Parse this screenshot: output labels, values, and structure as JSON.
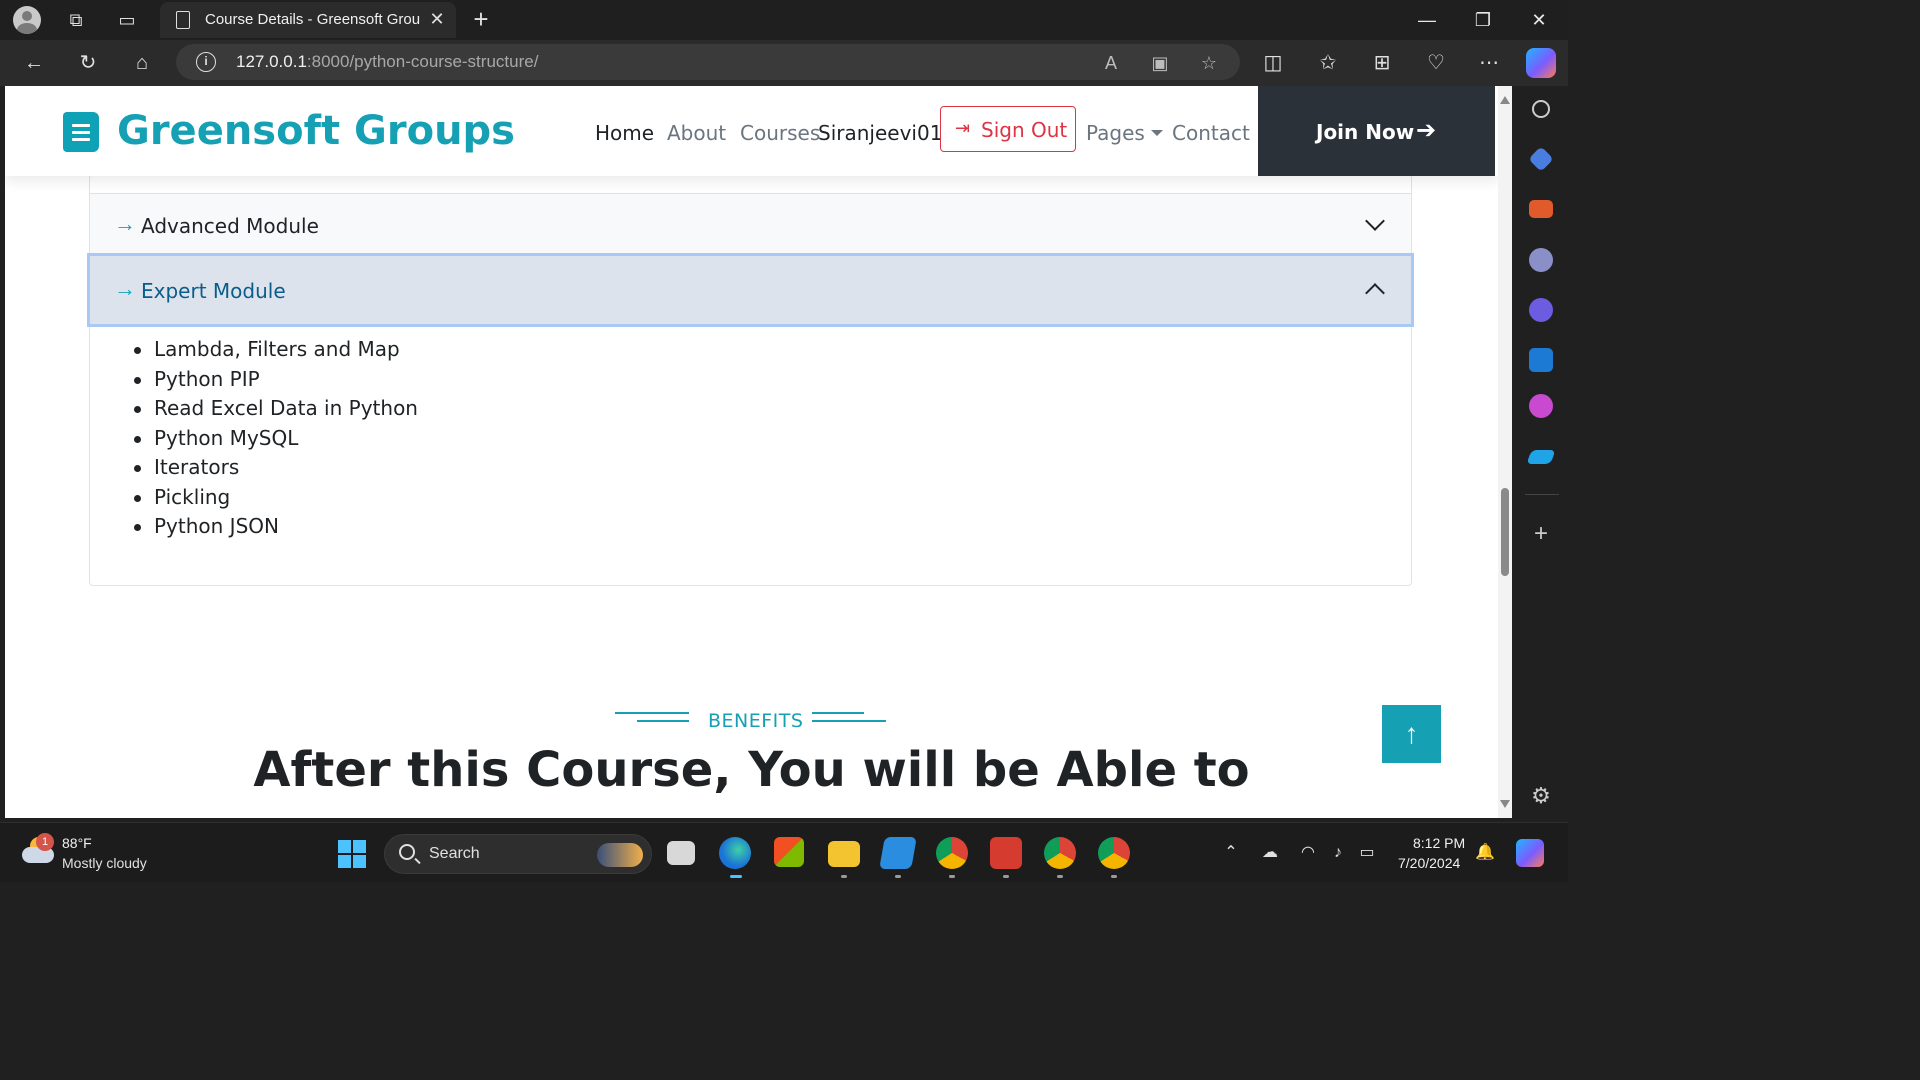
{
  "browser": {
    "tab_title": "Course Details - Greensoft Group",
    "url_host": "127.0.0.1",
    "url_rest": ":8000/python-course-structure/"
  },
  "site": {
    "brand": "Greensoft Groups",
    "nav": {
      "home": "Home",
      "about": "About",
      "courses": "Courses",
      "user": "Siranjeevi01",
      "signout": "Sign Out",
      "pages": "Pages",
      "contact": "Contact",
      "join": "Join Now"
    }
  },
  "accordion": {
    "advanced_title": "Advanced Module",
    "expert_title": "Expert Module",
    "expert_items": [
      "Lambda, Filters and Map",
      "Python PIP",
      "Read Excel Data in Python",
      "Python MySQL",
      "Iterators",
      "Pickling",
      "Python JSON"
    ]
  },
  "benefits": {
    "label": "BENEFITS",
    "heading": "After this Course, You will be Able to"
  },
  "taskbar": {
    "weather_badge": "1",
    "temperature": "88°F",
    "condition": "Mostly cloudy",
    "search_label": "Search",
    "time": "8:12 PM",
    "date": "7/20/2024"
  },
  "colors": {
    "brand_teal": "#16a0b4",
    "danger_red": "#dc3545",
    "join_bg": "#2b3138"
  }
}
